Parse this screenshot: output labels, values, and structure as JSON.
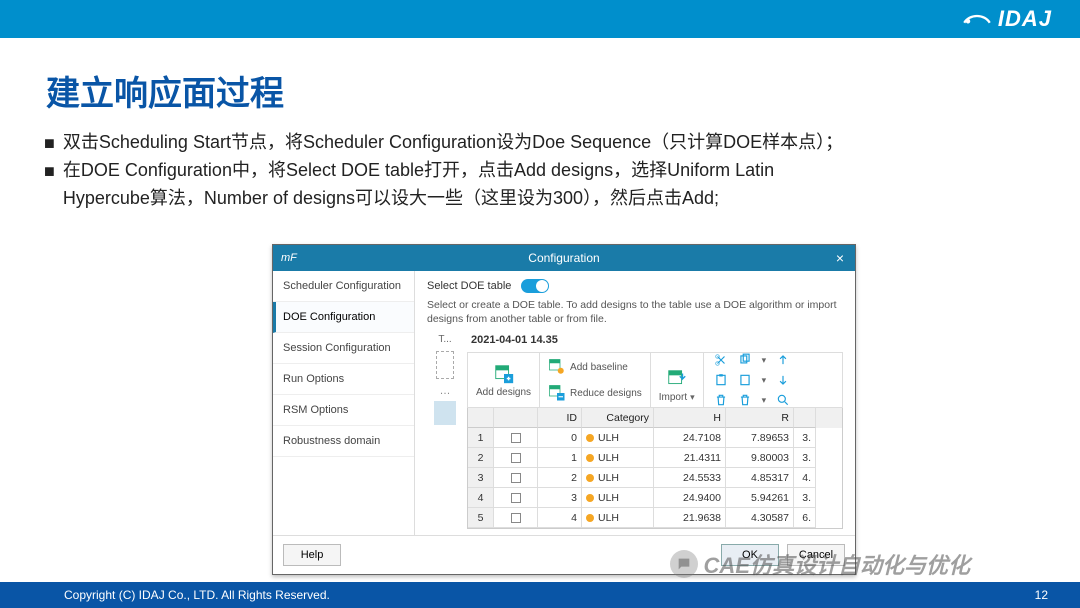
{
  "brand": "IDAJ",
  "slide_title": "建立响应面过程",
  "bullet1": "双击Scheduling Start节点，将Scheduler Configuration设为Doe Sequence（只计算DOE样本点）；",
  "bullet2a": "在DOE Configuration中，将Select DOE table打开，点击Add designs，选择Uniform Latin",
  "bullet2b": "Hypercube算法，Number of designs可以设大一些（这里设为300），然后点击Add;",
  "dialog": {
    "app": "mF",
    "title": "Configuration",
    "sidebar": [
      "Scheduler Configuration",
      "DOE Configuration",
      "Session Configuration",
      "Run Options",
      "RSM Options",
      "Robustness domain"
    ],
    "toggle_label": "Select DOE table",
    "desc": "Select or create a DOE table. To add designs to the table use a DOE algorithm or import designs from another table or from file.",
    "slice_label": "T...",
    "timestamp": "2021-04-01 14.35",
    "tb": {
      "add_designs": "Add designs",
      "add_baseline": "Add baseline",
      "reduce_designs": "Reduce designs",
      "import": "Import"
    },
    "columns": [
      "",
      "",
      "ID",
      "Category",
      "H",
      "R",
      ""
    ],
    "rows": [
      {
        "n": "1",
        "id": "0",
        "cat": "ULH",
        "h": "24.7108",
        "r": "7.89653",
        "x": "3."
      },
      {
        "n": "2",
        "id": "1",
        "cat": "ULH",
        "h": "21.4311",
        "r": "9.80003",
        "x": "3."
      },
      {
        "n": "3",
        "id": "2",
        "cat": "ULH",
        "h": "24.5533",
        "r": "4.85317",
        "x": "4."
      },
      {
        "n": "4",
        "id": "3",
        "cat": "ULH",
        "h": "24.9400",
        "r": "5.94261",
        "x": "3."
      },
      {
        "n": "5",
        "id": "4",
        "cat": "ULH",
        "h": "21.9638",
        "r": "4.30587",
        "x": "6."
      }
    ],
    "help": "Help",
    "ok": "OK",
    "cancel": "Cancel"
  },
  "watermark": "CAE仿真设计自动化与优化",
  "copyright": "Copyright (C)  IDAJ Co., LTD.  All Rights Reserved.",
  "page": "12"
}
